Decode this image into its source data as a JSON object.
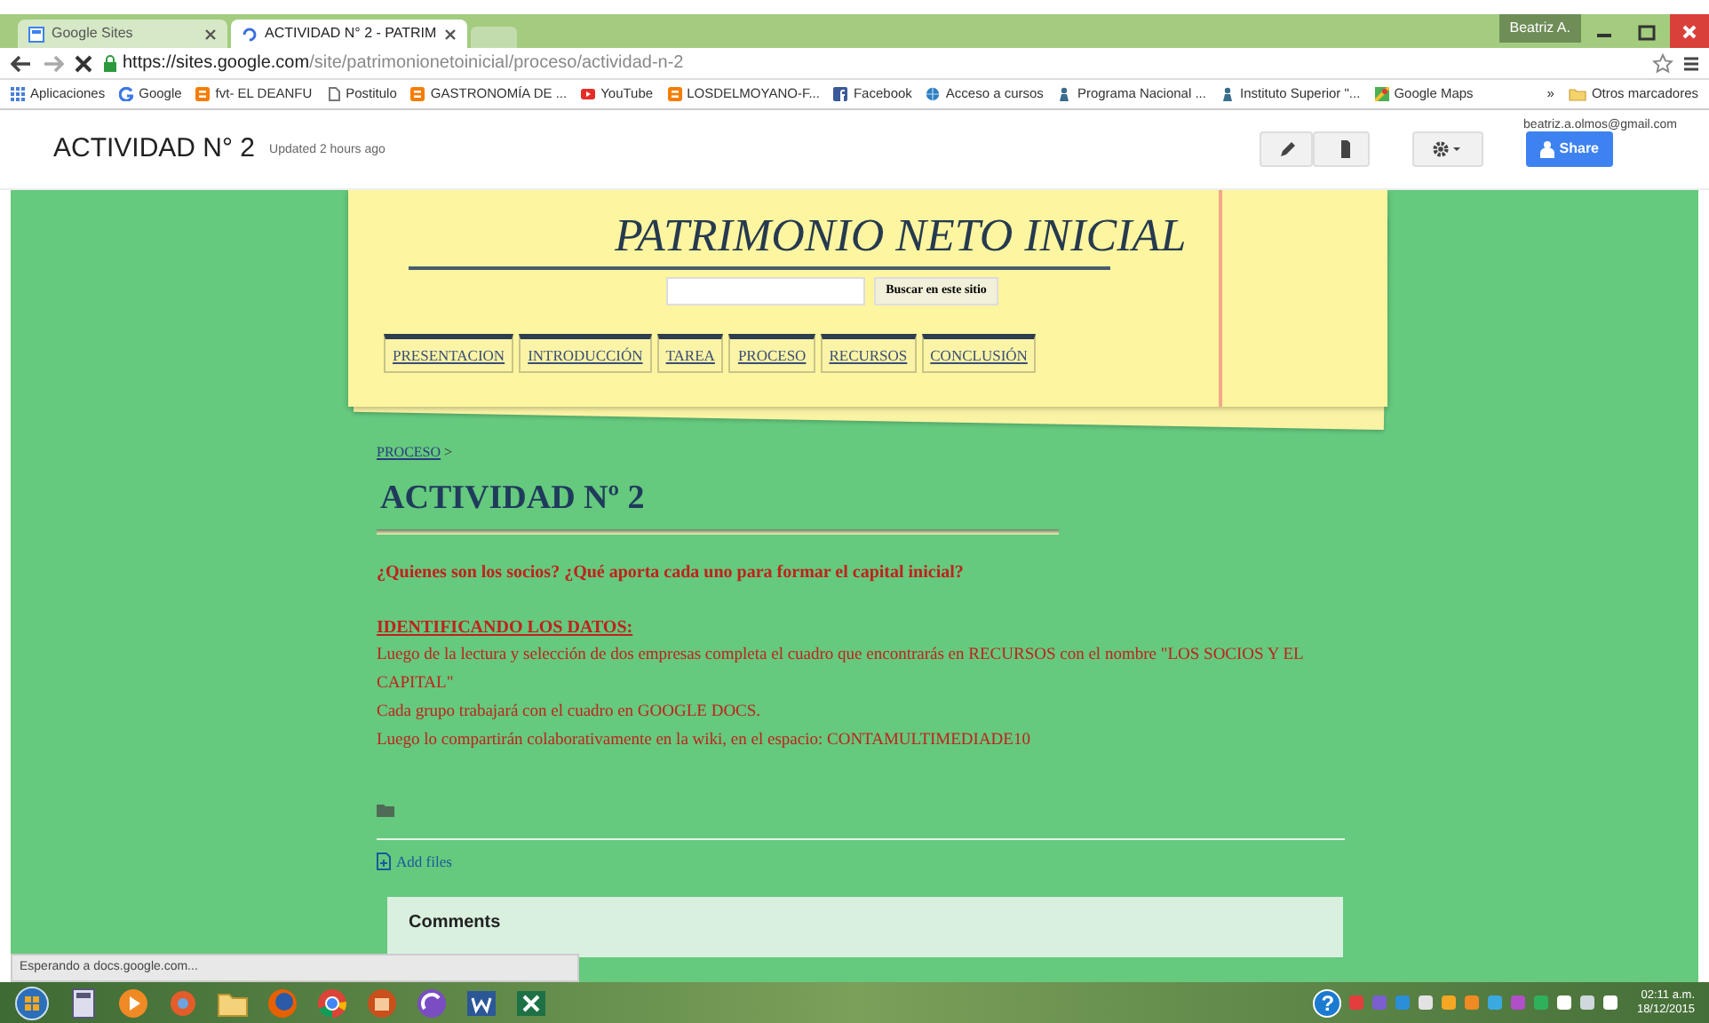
{
  "browser": {
    "tabs": [
      {
        "title": "Google Sites",
        "selected": false
      },
      {
        "title": "ACTIVIDAD N° 2 - PATRIM",
        "selected": true
      }
    ],
    "profile": "Beatriz A.",
    "url": {
      "host": "https://sites.google.com",
      "path": "/site/patrimonionetoinicial/proceso/actividad-n-2"
    },
    "bookmarks": [
      {
        "label": "Aplicaciones",
        "kind": "apps"
      },
      {
        "label": "Google",
        "kind": "google"
      },
      {
        "label": "fvt- EL DEANFU",
        "kind": "blogger"
      },
      {
        "label": "Postitulo",
        "kind": "page"
      },
      {
        "label": "GASTRONOMÍA DE ...",
        "kind": "blogger"
      },
      {
        "label": "YouTube",
        "kind": "youtube"
      },
      {
        "label": "LOSDELMOYANO-F...",
        "kind": "blogger"
      },
      {
        "label": "Facebook",
        "kind": "facebook"
      },
      {
        "label": "Acceso a cursos",
        "kind": "globe"
      },
      {
        "label": "Programa Nacional ...",
        "kind": "pin"
      },
      {
        "label": "Instituto Superior \"...",
        "kind": "pin"
      },
      {
        "label": "Google Maps",
        "kind": "maps"
      }
    ],
    "more": "»",
    "other_bookmarks": "Otros marcadores"
  },
  "site": {
    "title": "ACTIVIDAD N° 2",
    "updated": "Updated 2 hours ago",
    "user": "beatriz.a.olmos@gmail.com",
    "share": "Share"
  },
  "header": {
    "title": "PATRIMONIO NETO INICIAL",
    "search_button": "Buscar en este sitio",
    "nav": [
      "PRESENTACION",
      "INTRODUCCIÓN",
      "TAREA",
      "PROCESO",
      "RECURSOS",
      "CONCLUSIÓN"
    ]
  },
  "page": {
    "breadcrumb": "PROCESO",
    "breadcrumb_sep": ">",
    "heading": "ACTIVIDAD Nº 2",
    "question": "¿Quienes son los socios? ¿Qué aporta cada uno para formar el capital inicial?",
    "subheading": "IDENTIFICANDO LOS DATOS:",
    "paragraphs": [
      "Luego de la lectura y selección de dos empresas completa el cuadro que encontrarás en RECURSOS con el nombre \"LOS SOCIOS Y EL CAPITAL\"",
      "Cada grupo trabajará con el cuadro en GOOGLE DOCS.",
      "Luego lo compartirán colaborativamente en la wiki, en el espacio: CONTAMULTIMEDIADE10"
    ],
    "add_files": "Add files",
    "comments": "Comments"
  },
  "status": "Esperando a docs.google.com...",
  "taskbar": {
    "help": "?",
    "time": "02:11 a.m.",
    "date": "18/12/2015"
  }
}
